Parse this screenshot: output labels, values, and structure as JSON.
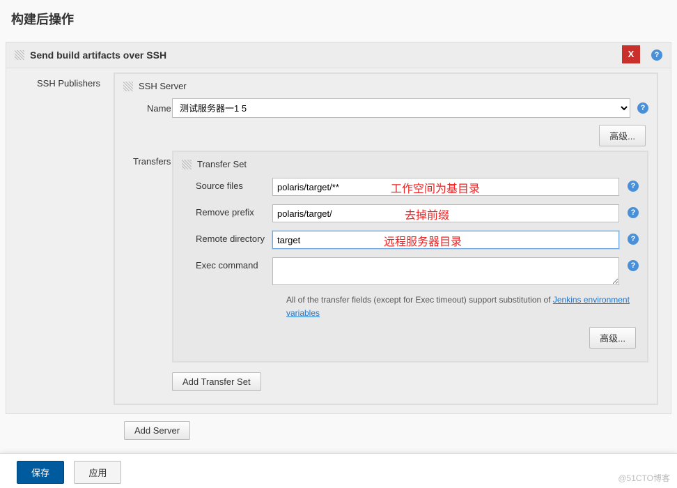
{
  "page": {
    "title": "构建后操作"
  },
  "section": {
    "title": "Send build artifacts over SSH",
    "close_label": "X",
    "publishers_label": "SSH Publishers"
  },
  "ssh_server": {
    "group_label": "SSH Server",
    "name_label": "Name",
    "selected": "测试服务器一1               5",
    "advanced_label": "高级..."
  },
  "transfers": {
    "label": "Transfers",
    "set_label": "Transfer Set",
    "source_files_label": "Source files",
    "source_files_value": "polaris/target/**",
    "remove_prefix_label": "Remove prefix",
    "remove_prefix_value": "polaris/target/",
    "remote_dir_label": "Remote directory",
    "remote_dir_value": "target",
    "exec_cmd_label": "Exec command",
    "exec_cmd_value": "",
    "note_prefix": "All of the transfer fields (except for Exec timeout) support substitution of ",
    "note_link": "Jenkins environment variables",
    "advanced_label": "高级...",
    "add_set_label": "Add Transfer Set"
  },
  "annotations": {
    "a1": "工作空间为基目录",
    "a2": "去掉前缀",
    "a3": "远程服务器目录"
  },
  "add_server_label": "Add Server",
  "footer": {
    "save": "保存",
    "apply": "应用"
  },
  "watermark": "@51CTO博客"
}
